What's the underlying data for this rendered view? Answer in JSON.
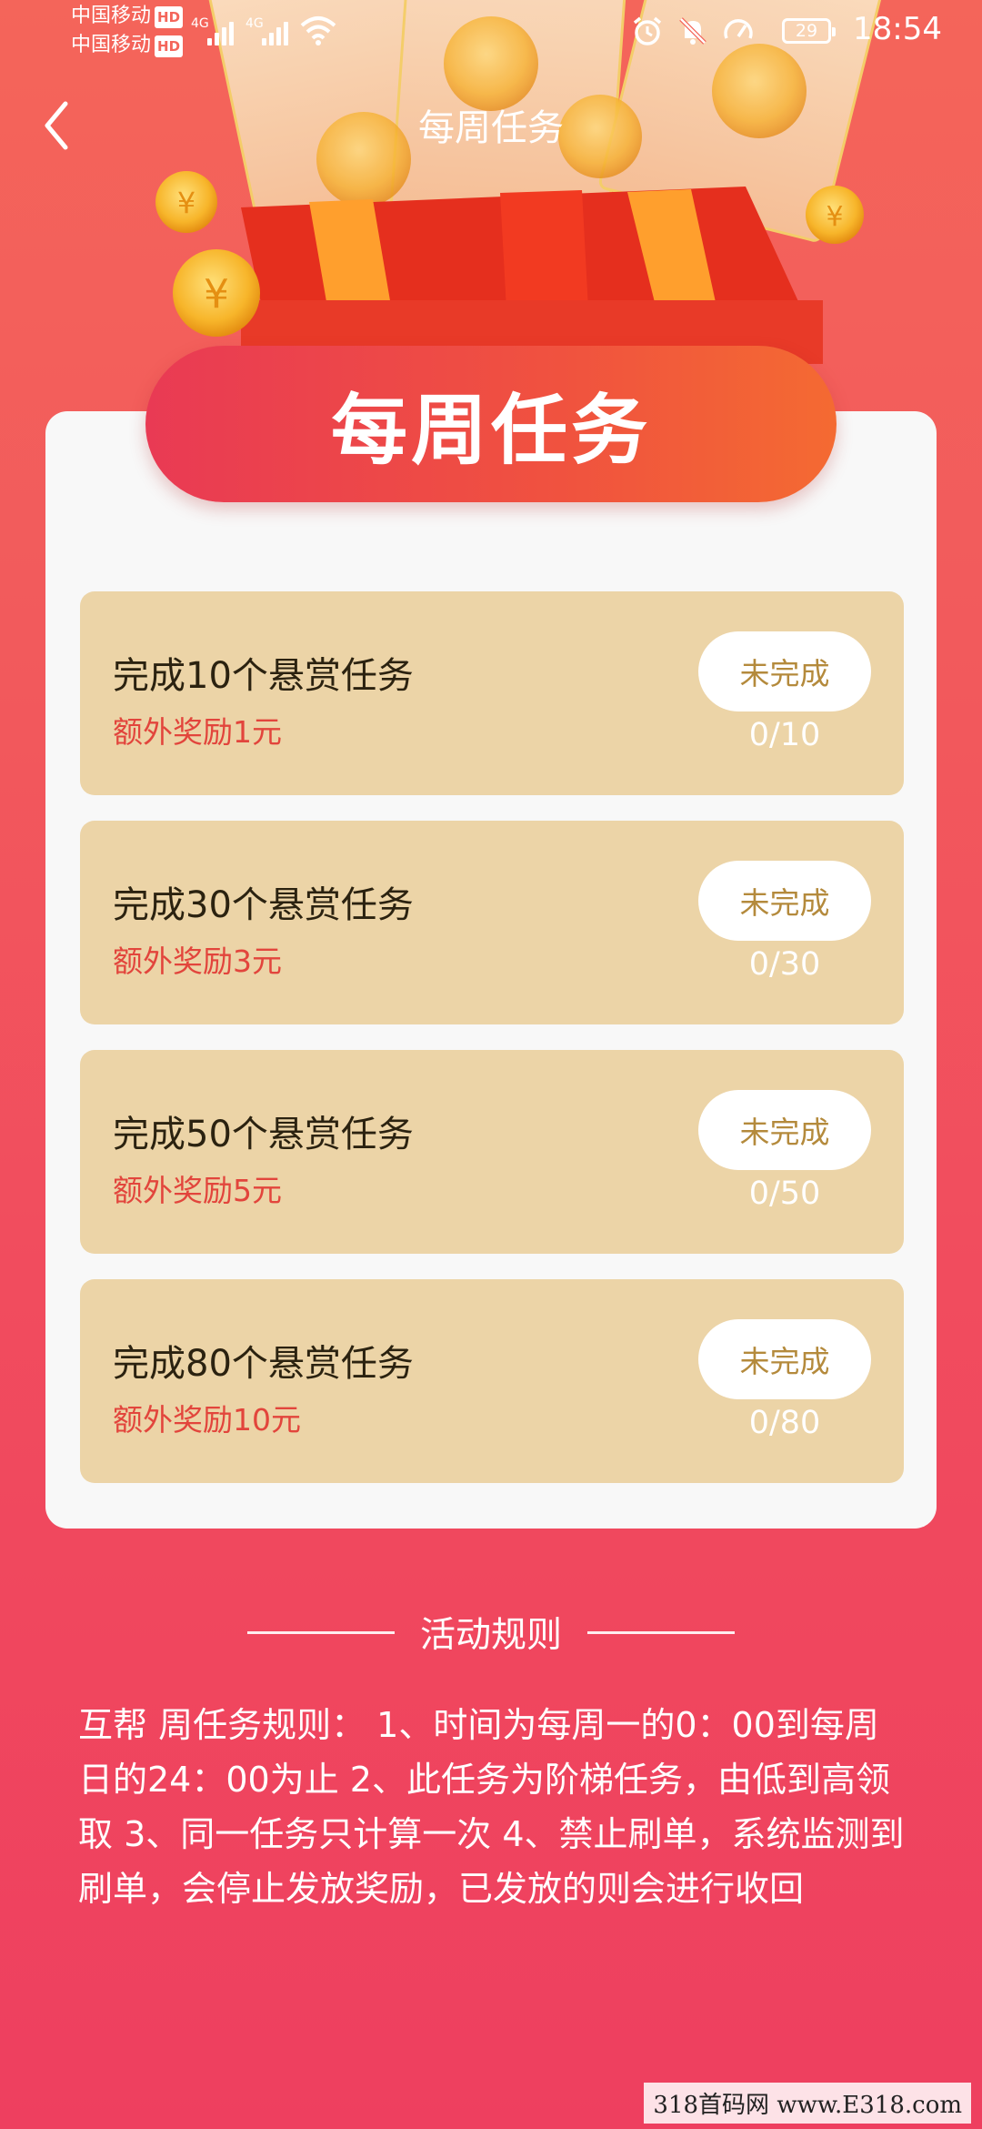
{
  "status_bar": {
    "carrier_1": "中国移动",
    "carrier_2": "中国移动",
    "hd_badge": "HD",
    "network_1": "4G",
    "network_2": "4G",
    "battery": "29",
    "time": "18:54"
  },
  "header": {
    "title": "每周任务"
  },
  "card": {
    "title": "每周任务"
  },
  "tasks": [
    {
      "name": "完成10个悬赏任务",
      "reward": "额外奖励1元",
      "status": "未完成",
      "progress": "0/10"
    },
    {
      "name": "完成30个悬赏任务",
      "reward": "额外奖励3元",
      "status": "未完成",
      "progress": "0/30"
    },
    {
      "name": "完成50个悬赏任务",
      "reward": "额外奖励5元",
      "status": "未完成",
      "progress": "0/50"
    },
    {
      "name": "完成80个悬赏任务",
      "reward": "额外奖励10元",
      "status": "未完成",
      "progress": "0/80"
    }
  ],
  "rules": {
    "title": "活动规则",
    "text": "互帮 周任务规则： 1、时间为每周一的0：00到每周日的24：00为止 2、此任务为阶梯任务，由低到高领取 3、同一任务只计算一次 4、禁止刷单，系统监测到刷单，会停止发放奖励，已发放的则会进行收回"
  },
  "watermark": "318首码网 www.E318.com",
  "colors": {
    "background_top": "#f4655a",
    "background_bottom": "#ee3f5f",
    "task_card": "#ecd4a7",
    "reward_text": "#e2453c",
    "status_text": "#b48a3c"
  },
  "icons": [
    "back-chevron-icon",
    "wifi-icon",
    "alarm-icon",
    "bell-off-icon",
    "speed-icon",
    "battery-icon",
    "coin-icon",
    "red-envelope-icon"
  ]
}
